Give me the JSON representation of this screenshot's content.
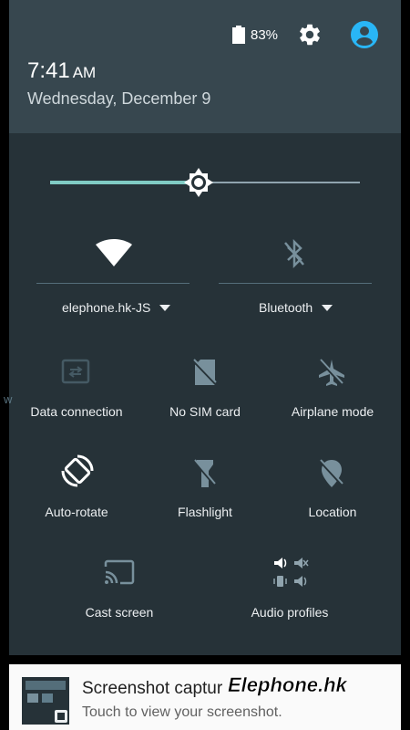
{
  "status_bar": {
    "battery_percent": "83%",
    "battery_icon": "battery-icon",
    "settings_icon": "gear-icon",
    "user_icon": "account-circle-icon"
  },
  "header": {
    "time": "7:41",
    "ampm": "AM",
    "date": "Wednesday, December 9"
  },
  "brightness": {
    "level": 0.48,
    "icon": "brightness-icon"
  },
  "wifi": {
    "label": "elephone.hk-JS",
    "icon": "wifi-icon"
  },
  "bluetooth": {
    "label": "Bluetooth",
    "icon": "bluetooth-off-icon"
  },
  "tiles": [
    {
      "label": "Data connection",
      "icon": "data-connection-icon",
      "enabled": false
    },
    {
      "label": "No SIM card",
      "icon": "no-sim-icon",
      "enabled": false
    },
    {
      "label": "Airplane mode",
      "icon": "airplane-off-icon",
      "enabled": false
    },
    {
      "label": "Auto-rotate",
      "icon": "auto-rotate-icon",
      "enabled": true
    },
    {
      "label": "Flashlight",
      "icon": "flashlight-off-icon",
      "enabled": false
    },
    {
      "label": "Location",
      "icon": "location-off-icon",
      "enabled": false
    },
    {
      "label": "Cast screen",
      "icon": "cast-icon",
      "enabled": false
    },
    {
      "label": "Audio profiles",
      "icon": "audio-profiles-icon",
      "enabled": false
    }
  ],
  "notification": {
    "title": "Screenshot captur",
    "subtitle": "Touch to view your screenshot."
  },
  "watermark": "Elephone.hk",
  "edge_char": "W",
  "colors": {
    "shade_bg": "#263238",
    "header_bg": "#37474f",
    "accent": "#80cbc4",
    "avatar": "#29b6f6"
  }
}
